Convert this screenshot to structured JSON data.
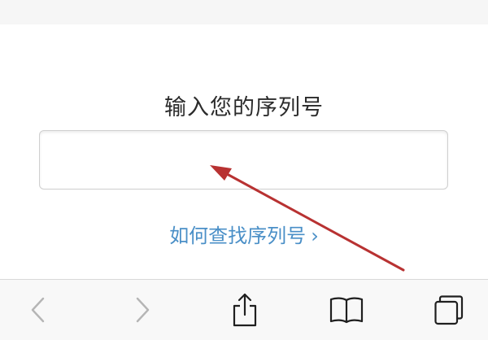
{
  "form": {
    "label": "输入您的序列号",
    "serial_value": "",
    "help_link": "如何查找序列号",
    "help_chevron": "›"
  },
  "toolbar": {
    "buttons": [
      {
        "icon": "back-icon",
        "label": "<"
      },
      {
        "icon": "forward-icon",
        "label": ">"
      },
      {
        "icon": "share-icon"
      },
      {
        "icon": "bookmarks-icon"
      },
      {
        "icon": "tabs-icon"
      }
    ]
  },
  "colors": {
    "link": "#4a8fc7",
    "arrow": "#b83232",
    "toolbar_bg": "#f8f8f8",
    "icon_active": "#1f1f1f",
    "icon_disabled": "#b5b5b5"
  }
}
